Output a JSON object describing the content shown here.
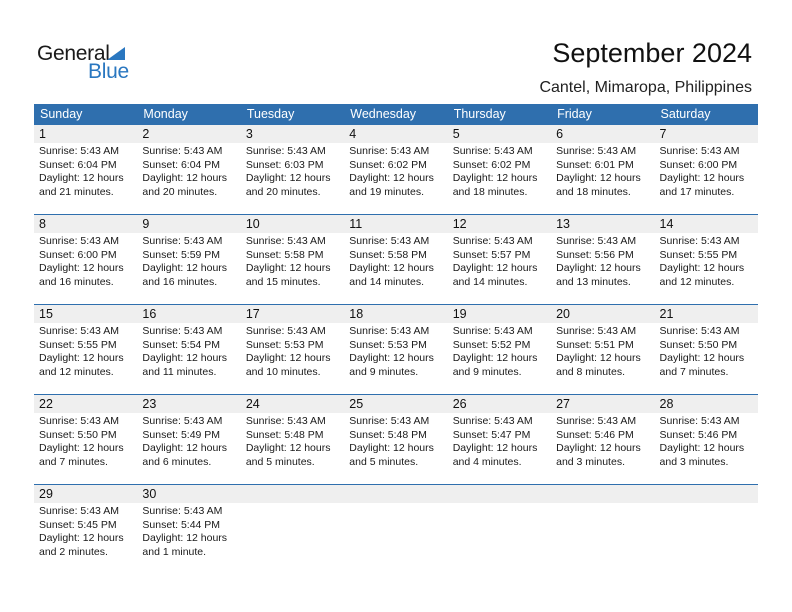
{
  "logo": {
    "text1": "General",
    "text2": "Blue"
  },
  "header": {
    "title": "September 2024",
    "location": "Cantel, Mimaropa, Philippines"
  },
  "colors": {
    "accent": "#2f6fae",
    "daynum_bg": "#efefef",
    "logo_blue": "#2a77c0"
  },
  "weekdays": [
    "Sunday",
    "Monday",
    "Tuesday",
    "Wednesday",
    "Thursday",
    "Friday",
    "Saturday"
  ],
  "weeks": [
    [
      {
        "day": "1",
        "sunrise": "Sunrise: 5:43 AM",
        "sunset": "Sunset: 6:04 PM",
        "daylight1": "Daylight: 12 hours",
        "daylight2": "and 21 minutes."
      },
      {
        "day": "2",
        "sunrise": "Sunrise: 5:43 AM",
        "sunset": "Sunset: 6:04 PM",
        "daylight1": "Daylight: 12 hours",
        "daylight2": "and 20 minutes."
      },
      {
        "day": "3",
        "sunrise": "Sunrise: 5:43 AM",
        "sunset": "Sunset: 6:03 PM",
        "daylight1": "Daylight: 12 hours",
        "daylight2": "and 20 minutes."
      },
      {
        "day": "4",
        "sunrise": "Sunrise: 5:43 AM",
        "sunset": "Sunset: 6:02 PM",
        "daylight1": "Daylight: 12 hours",
        "daylight2": "and 19 minutes."
      },
      {
        "day": "5",
        "sunrise": "Sunrise: 5:43 AM",
        "sunset": "Sunset: 6:02 PM",
        "daylight1": "Daylight: 12 hours",
        "daylight2": "and 18 minutes."
      },
      {
        "day": "6",
        "sunrise": "Sunrise: 5:43 AM",
        "sunset": "Sunset: 6:01 PM",
        "daylight1": "Daylight: 12 hours",
        "daylight2": "and 18 minutes."
      },
      {
        "day": "7",
        "sunrise": "Sunrise: 5:43 AM",
        "sunset": "Sunset: 6:00 PM",
        "daylight1": "Daylight: 12 hours",
        "daylight2": "and 17 minutes."
      }
    ],
    [
      {
        "day": "8",
        "sunrise": "Sunrise: 5:43 AM",
        "sunset": "Sunset: 6:00 PM",
        "daylight1": "Daylight: 12 hours",
        "daylight2": "and 16 minutes."
      },
      {
        "day": "9",
        "sunrise": "Sunrise: 5:43 AM",
        "sunset": "Sunset: 5:59 PM",
        "daylight1": "Daylight: 12 hours",
        "daylight2": "and 16 minutes."
      },
      {
        "day": "10",
        "sunrise": "Sunrise: 5:43 AM",
        "sunset": "Sunset: 5:58 PM",
        "daylight1": "Daylight: 12 hours",
        "daylight2": "and 15 minutes."
      },
      {
        "day": "11",
        "sunrise": "Sunrise: 5:43 AM",
        "sunset": "Sunset: 5:58 PM",
        "daylight1": "Daylight: 12 hours",
        "daylight2": "and 14 minutes."
      },
      {
        "day": "12",
        "sunrise": "Sunrise: 5:43 AM",
        "sunset": "Sunset: 5:57 PM",
        "daylight1": "Daylight: 12 hours",
        "daylight2": "and 14 minutes."
      },
      {
        "day": "13",
        "sunrise": "Sunrise: 5:43 AM",
        "sunset": "Sunset: 5:56 PM",
        "daylight1": "Daylight: 12 hours",
        "daylight2": "and 13 minutes."
      },
      {
        "day": "14",
        "sunrise": "Sunrise: 5:43 AM",
        "sunset": "Sunset: 5:55 PM",
        "daylight1": "Daylight: 12 hours",
        "daylight2": "and 12 minutes."
      }
    ],
    [
      {
        "day": "15",
        "sunrise": "Sunrise: 5:43 AM",
        "sunset": "Sunset: 5:55 PM",
        "daylight1": "Daylight: 12 hours",
        "daylight2": "and 12 minutes."
      },
      {
        "day": "16",
        "sunrise": "Sunrise: 5:43 AM",
        "sunset": "Sunset: 5:54 PM",
        "daylight1": "Daylight: 12 hours",
        "daylight2": "and 11 minutes."
      },
      {
        "day": "17",
        "sunrise": "Sunrise: 5:43 AM",
        "sunset": "Sunset: 5:53 PM",
        "daylight1": "Daylight: 12 hours",
        "daylight2": "and 10 minutes."
      },
      {
        "day": "18",
        "sunrise": "Sunrise: 5:43 AM",
        "sunset": "Sunset: 5:53 PM",
        "daylight1": "Daylight: 12 hours",
        "daylight2": "and 9 minutes."
      },
      {
        "day": "19",
        "sunrise": "Sunrise: 5:43 AM",
        "sunset": "Sunset: 5:52 PM",
        "daylight1": "Daylight: 12 hours",
        "daylight2": "and 9 minutes."
      },
      {
        "day": "20",
        "sunrise": "Sunrise: 5:43 AM",
        "sunset": "Sunset: 5:51 PM",
        "daylight1": "Daylight: 12 hours",
        "daylight2": "and 8 minutes."
      },
      {
        "day": "21",
        "sunrise": "Sunrise: 5:43 AM",
        "sunset": "Sunset: 5:50 PM",
        "daylight1": "Daylight: 12 hours",
        "daylight2": "and 7 minutes."
      }
    ],
    [
      {
        "day": "22",
        "sunrise": "Sunrise: 5:43 AM",
        "sunset": "Sunset: 5:50 PM",
        "daylight1": "Daylight: 12 hours",
        "daylight2": "and 7 minutes."
      },
      {
        "day": "23",
        "sunrise": "Sunrise: 5:43 AM",
        "sunset": "Sunset: 5:49 PM",
        "daylight1": "Daylight: 12 hours",
        "daylight2": "and 6 minutes."
      },
      {
        "day": "24",
        "sunrise": "Sunrise: 5:43 AM",
        "sunset": "Sunset: 5:48 PM",
        "daylight1": "Daylight: 12 hours",
        "daylight2": "and 5 minutes."
      },
      {
        "day": "25",
        "sunrise": "Sunrise: 5:43 AM",
        "sunset": "Sunset: 5:48 PM",
        "daylight1": "Daylight: 12 hours",
        "daylight2": "and 5 minutes."
      },
      {
        "day": "26",
        "sunrise": "Sunrise: 5:43 AM",
        "sunset": "Sunset: 5:47 PM",
        "daylight1": "Daylight: 12 hours",
        "daylight2": "and 4 minutes."
      },
      {
        "day": "27",
        "sunrise": "Sunrise: 5:43 AM",
        "sunset": "Sunset: 5:46 PM",
        "daylight1": "Daylight: 12 hours",
        "daylight2": "and 3 minutes."
      },
      {
        "day": "28",
        "sunrise": "Sunrise: 5:43 AM",
        "sunset": "Sunset: 5:46 PM",
        "daylight1": "Daylight: 12 hours",
        "daylight2": "and 3 minutes."
      }
    ],
    [
      {
        "day": "29",
        "sunrise": "Sunrise: 5:43 AM",
        "sunset": "Sunset: 5:45 PM",
        "daylight1": "Daylight: 12 hours",
        "daylight2": "and 2 minutes."
      },
      {
        "day": "30",
        "sunrise": "Sunrise: 5:43 AM",
        "sunset": "Sunset: 5:44 PM",
        "daylight1": "Daylight: 12 hours",
        "daylight2": "and 1 minute."
      },
      {
        "day": "",
        "sunrise": "",
        "sunset": "",
        "daylight1": "",
        "daylight2": ""
      },
      {
        "day": "",
        "sunrise": "",
        "sunset": "",
        "daylight1": "",
        "daylight2": ""
      },
      {
        "day": "",
        "sunrise": "",
        "sunset": "",
        "daylight1": "",
        "daylight2": ""
      },
      {
        "day": "",
        "sunrise": "",
        "sunset": "",
        "daylight1": "",
        "daylight2": ""
      },
      {
        "day": "",
        "sunrise": "",
        "sunset": "",
        "daylight1": "",
        "daylight2": ""
      }
    ]
  ]
}
